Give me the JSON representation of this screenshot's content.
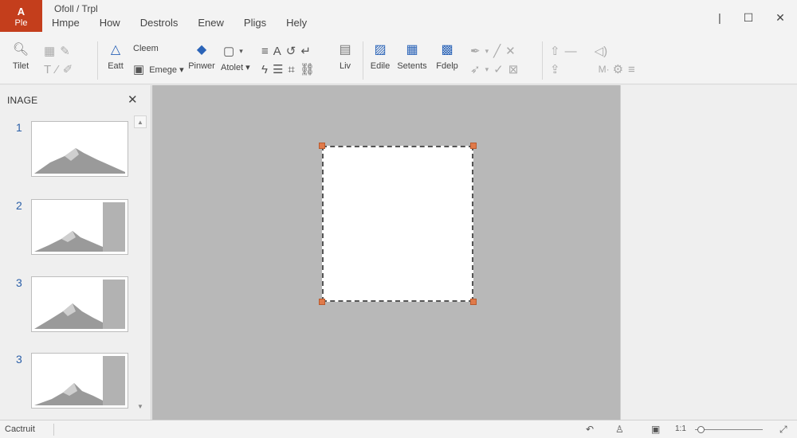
{
  "app": {
    "file_logo": "A",
    "file_label": "Ple",
    "doc_title": "Ofoll / Trpl"
  },
  "menus": [
    "Hmpe",
    "How",
    "Destrols",
    "Enew",
    "Pligs",
    "Hely"
  ],
  "window_controls": {
    "minimize": "|",
    "maximize": "☐",
    "close": "✕"
  },
  "ribbon": {
    "tilet_label": "Tilet",
    "east_label": "Eatt",
    "cleem_label": "Cleem",
    "emege_label": "Emege ▾",
    "pinwer_label": "Pinwer",
    "atolet_label": "Atolet ▾",
    "liv_label": "Liv",
    "edile_label": "Edile",
    "setents_label": "Setents",
    "fdelp_label": "Fdelp",
    "m_label": "M·"
  },
  "panel": {
    "title": "INAGE",
    "thumbnails": [
      {
        "number": "1"
      },
      {
        "number": "2"
      },
      {
        "number": "3"
      },
      {
        "number": "3"
      }
    ]
  },
  "status": {
    "text": "Cactruit",
    "zoom_label": "1:1",
    "zoom_level": 0.04
  },
  "colors": {
    "file_accent": "#c43e1c",
    "handle": "#e07a4a",
    "thumb_number": "#2b5fa8"
  }
}
